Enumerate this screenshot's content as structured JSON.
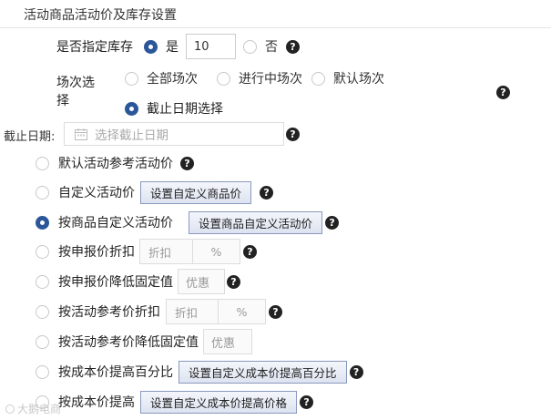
{
  "header": {
    "title": "活动商品活动价及库存设置"
  },
  "stock": {
    "label": "是否指定库存",
    "yes_label": "是",
    "value": "10",
    "no_label": "否"
  },
  "session": {
    "label_line1": "场次选",
    "label_line2": "择",
    "options": [
      "全部场次",
      "进行中场次",
      "默认场次",
      "截止日期选择"
    ]
  },
  "deadline": {
    "label": "截止日期:",
    "placeholder": "选择截止日期"
  },
  "price_options": [
    {
      "label": "默认活动参考活动价"
    },
    {
      "label": "自定义活动价",
      "button": "设置自定义商品价"
    },
    {
      "label": "按商品自定义活动价",
      "button": "设置商品自定义活动价"
    },
    {
      "label": "按申报价折扣",
      "input_placeholder": "折扣",
      "suffix": "%"
    },
    {
      "label": "按申报价降低固定值",
      "input_placeholder": "优惠"
    },
    {
      "label": "按活动参考价折扣",
      "input_placeholder": "折扣",
      "suffix": "%"
    },
    {
      "label": "按活动参考价降低固定值",
      "input_placeholder": "优惠"
    },
    {
      "label": "按成本价提高百分比",
      "button": "设置自定义成本价提高百分比"
    },
    {
      "label": "按成本价提高",
      "button": "设置自定义成本价提高价格"
    }
  ],
  "help_glyph": "?",
  "watermark": "大鹅电商",
  "colors": {
    "selected_radio": "#2b579a",
    "button_border": "#8a99bd"
  }
}
